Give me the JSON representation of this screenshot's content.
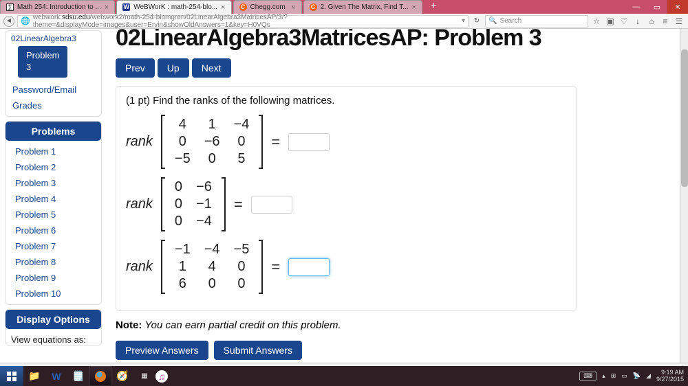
{
  "window": {
    "min": "—",
    "max": "▭",
    "close": "✕"
  },
  "tabs": [
    {
      "title": "Math 254: Introduction to ...",
      "icon": "math"
    },
    {
      "title": "WeBWorK : math-254-blo...",
      "icon": "ww",
      "active": true
    },
    {
      "title": "Chegg.com",
      "icon": "chegg"
    },
    {
      "title": "2. Given The Matrix, Find T...",
      "icon": "chegg"
    }
  ],
  "addr": {
    "url_pre": "webwork.",
    "url_host": "sdsu.edu",
    "url_rest": "/webwork2/math-254-blomgren/02LinearAlgebra3MatricesAP/3/?theme=&displayMode=images&user=Ervin&showOldAnswers=1&key=H0VQs",
    "search_placeholder": "Search"
  },
  "sidebar": {
    "breadcrumb": "02LinearAlgebra3",
    "current": "Problem\n3",
    "links": [
      "Password/Email",
      "Grades"
    ],
    "problems_header": "Problems",
    "problems": [
      "Problem 1",
      "Problem 2",
      "Problem 3",
      "Problem 4",
      "Problem 5",
      "Problem 6",
      "Problem 7",
      "Problem 8",
      "Problem 9",
      "Problem 10"
    ],
    "display_header": "Display Options",
    "display_text": "View equations as:"
  },
  "main": {
    "title": "02LinearAlgebra3MatricesAP: Problem 3",
    "nav": {
      "prev": "Prev",
      "up": "Up",
      "next": "Next"
    },
    "prompt": "(1 pt) Find the ranks of the following matrices.",
    "note_label": "Note:",
    "note_text": "You can earn partial credit on this problem.",
    "preview": "Preview Answers",
    "submit": "Submit Answers",
    "rank_label": "rank",
    "eq": "=",
    "matrices": [
      [
        [
          4,
          1,
          -4
        ],
        [
          0,
          -6,
          0
        ],
        [
          -5,
          0,
          5
        ]
      ],
      [
        [
          0,
          -6
        ],
        [
          0,
          -1
        ],
        [
          0,
          -4
        ]
      ],
      [
        [
          -1,
          -4,
          -5
        ],
        [
          1,
          4,
          0
        ],
        [
          6,
          0,
          0
        ]
      ]
    ]
  },
  "clock": {
    "time": "9:19 AM",
    "date": "9/27/2015"
  }
}
